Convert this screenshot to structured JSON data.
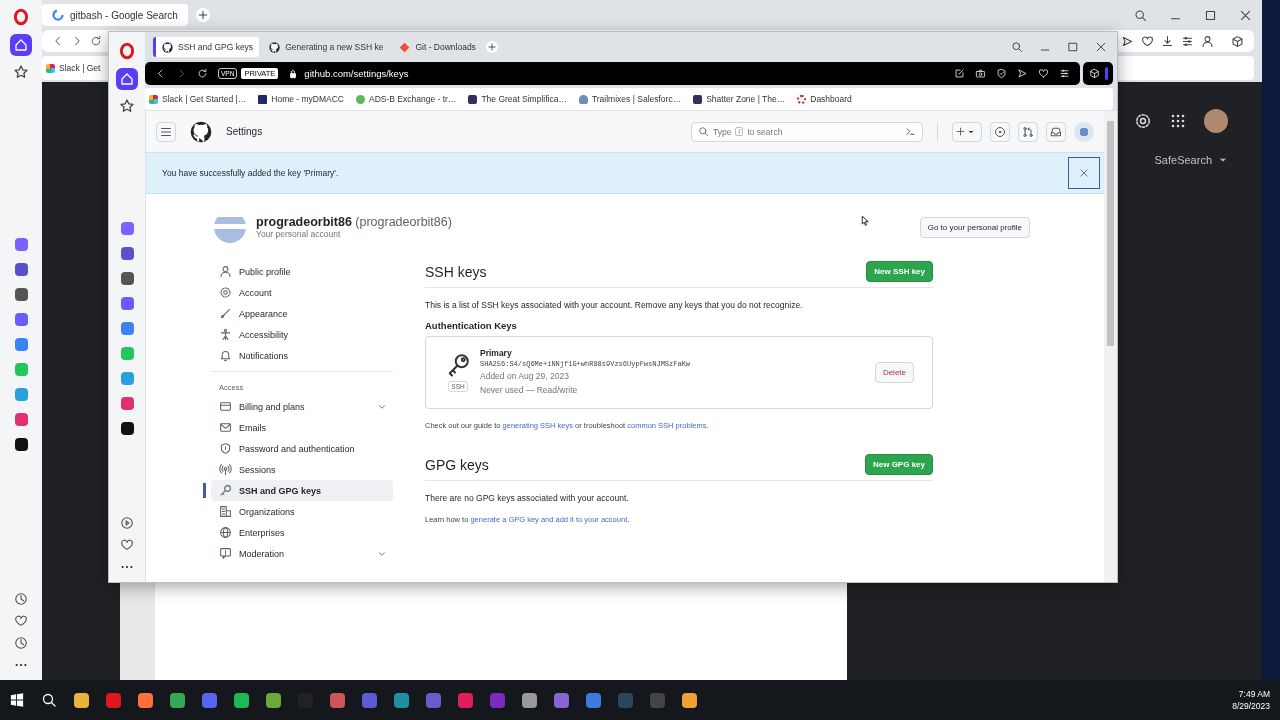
{
  "back_window": {
    "tabs": [
      {
        "label": "gitbash - Google Search",
        "selected": true
      }
    ],
    "bookmarks": [
      {
        "label": "Slack | Get"
      }
    ],
    "safesearch": "SafeSearch"
  },
  "front_window": {
    "tabs": [
      {
        "label": "SSH and GPG keys",
        "selected": true
      },
      {
        "label": "Generating a new SSH ke",
        "selected": false
      },
      {
        "label": "Git - Downloads",
        "selected": false
      }
    ],
    "vpn": "VPN",
    "private": "PRIVATE",
    "address": "github.com/settings/keys",
    "bookmarks": [
      {
        "label": "Slack | Get Started |…"
      },
      {
        "label": "Home - myDMACC"
      },
      {
        "label": "ADS-B Exchange - tr…"
      },
      {
        "label": "The Great Simplifica…"
      },
      {
        "label": "Trailmixes | Salesforc…"
      },
      {
        "label": "Shatter Zone | The…"
      },
      {
        "label": "Dashboard"
      }
    ]
  },
  "github": {
    "title": "Settings",
    "search": {
      "before": "Type",
      "key": "/",
      "after": "to search"
    },
    "flash": "You have successfully added the key 'Primary'.",
    "user": {
      "name": "progradeorbit86",
      "login": "(progradeorbit86)",
      "subtitle": "Your personal account"
    },
    "profile_button": "Go to your personal profile",
    "nav_groups": [
      {
        "items": [
          {
            "label": "Public profile",
            "selected": false,
            "has_submenu": false
          },
          {
            "label": "Account",
            "selected": false,
            "has_submenu": false
          },
          {
            "label": "Appearance",
            "selected": false,
            "has_submenu": false
          },
          {
            "label": "Accessibility",
            "selected": false,
            "has_submenu": false
          },
          {
            "label": "Notifications",
            "selected": false,
            "has_submenu": false
          }
        ]
      },
      {
        "heading": "Access",
        "items": [
          {
            "label": "Billing and plans",
            "selected": false,
            "has_submenu": true
          },
          {
            "label": "Emails",
            "selected": false,
            "has_submenu": false
          },
          {
            "label": "Password and authentication",
            "selected": false,
            "has_submenu": false
          },
          {
            "label": "Sessions",
            "selected": false,
            "has_submenu": false
          },
          {
            "label": "SSH and GPG keys",
            "selected": true,
            "has_submenu": false
          },
          {
            "label": "Organizations",
            "selected": false,
            "has_submenu": false
          },
          {
            "label": "Enterprises",
            "selected": false,
            "has_submenu": false
          },
          {
            "label": "Moderation",
            "selected": false,
            "has_submenu": true
          }
        ]
      }
    ],
    "sections": [
      {
        "title": "SSH keys",
        "button": "New SSH key",
        "intro": "This is a list of SSH keys associated with your account. Remove any keys that you do not recognize.",
        "subheading": "Authentication Keys",
        "keys": [
          {
            "title": "Primary",
            "badge": "SSH",
            "fingerprint": "SHA256:S4/sQ6Me+iNNjf1G+whR88s9Vzs6UypFwsNJMSzFaKw",
            "added": "Added on Aug 29, 2023",
            "usage": "Never used — Read/write",
            "action": "Delete"
          }
        ],
        "help": [
          {
            "text": "Check out our guide to "
          },
          {
            "text": "generating SSH keys",
            "link": true
          },
          {
            "text": " or troubleshoot "
          },
          {
            "text": "common SSH problems",
            "link": true
          },
          {
            "text": "."
          }
        ]
      },
      {
        "title": "GPG keys",
        "button": "New GPG key",
        "intro": "There are no GPG keys associated with your account.",
        "help": [
          {
            "text": "Learn how to "
          },
          {
            "text": "generate a GPG key and add it to your account",
            "link": true
          },
          {
            "text": "."
          }
        ]
      }
    ]
  },
  "taskbar": {
    "time": "7:49 AM",
    "date": "8/29/2023"
  }
}
